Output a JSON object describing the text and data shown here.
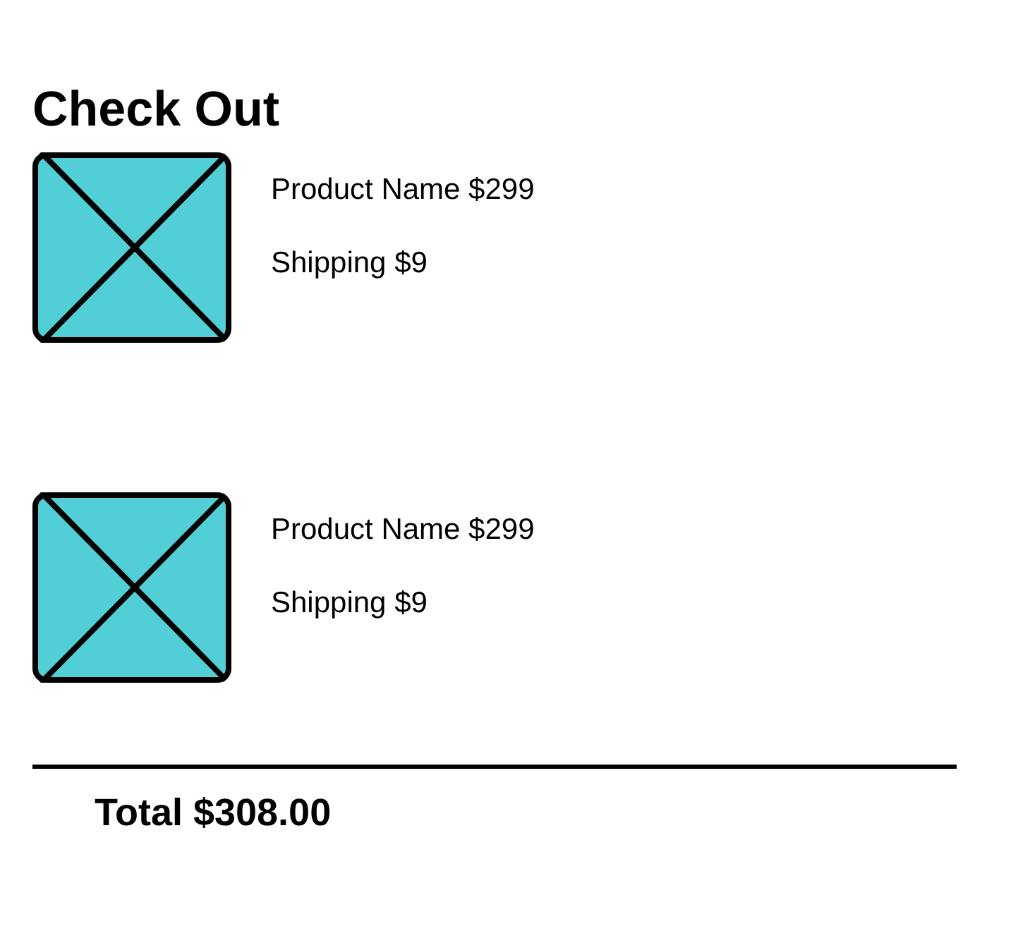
{
  "title": "Check Out",
  "items": [
    {
      "product": "Product Name $299",
      "shipping": "Shipping $9"
    },
    {
      "product": "Product Name $299",
      "shipping": "Shipping $9"
    }
  ],
  "total": "Total $308.00"
}
